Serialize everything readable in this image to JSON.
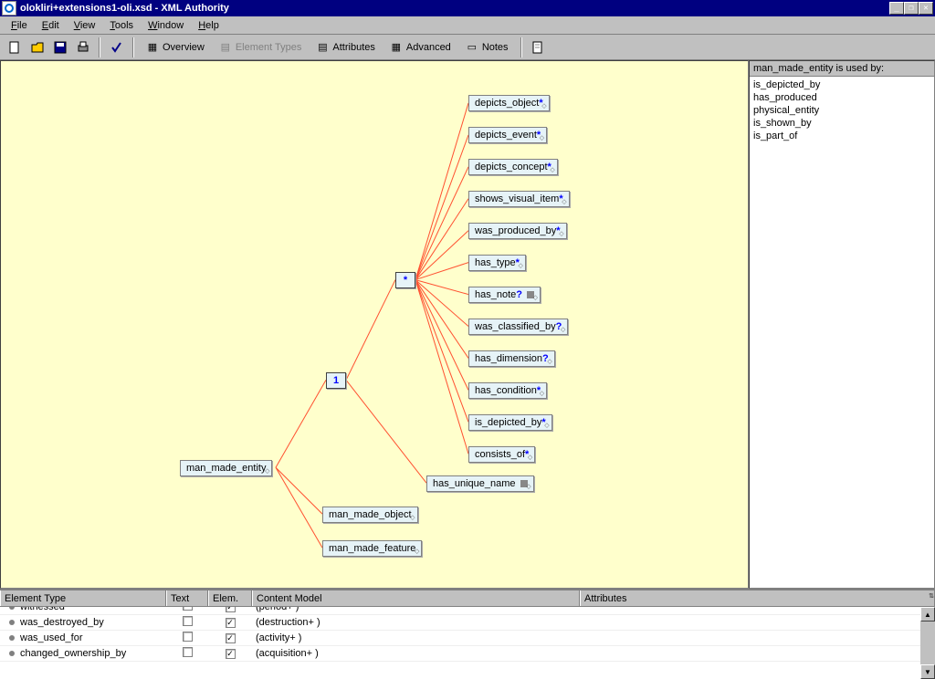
{
  "title": "olokliri+extensions1-oli.xsd - XML Authority",
  "menu": {
    "file": "File",
    "edit": "Edit",
    "view": "View",
    "tools": "Tools",
    "window": "Window",
    "help": "Help"
  },
  "toolbar": {
    "overview": "Overview",
    "elemtypes": "Element Types",
    "attributes": "Attributes",
    "advanced": "Advanced",
    "notes": "Notes"
  },
  "tree": {
    "root": "man_made_entity",
    "seq_card": "1",
    "choice_card": "*",
    "children_star": [
      {
        "label": "depicts_object",
        "suf": "*"
      },
      {
        "label": "depicts_event",
        "suf": "*"
      },
      {
        "label": "depicts_concept",
        "suf": "*"
      },
      {
        "label": "shows_visual_item",
        "suf": "*"
      },
      {
        "label": "was_produced_by",
        "suf": "*"
      },
      {
        "label": "has_type",
        "suf": "*"
      },
      {
        "label": "has_note",
        "suf": "?",
        "note": true
      },
      {
        "label": "was_classified_by",
        "suf": "?"
      },
      {
        "label": "has_dimension",
        "suf": "?"
      },
      {
        "label": "has_condition",
        "suf": "*"
      },
      {
        "label": "is_depicted_by",
        "suf": "*"
      },
      {
        "label": "consists_of",
        "suf": "*"
      }
    ],
    "unique": "has_unique_name",
    "ext1": "man_made_object",
    "ext2": "man_made_feature"
  },
  "side": {
    "header": "man_made_entity is used by:",
    "items": [
      "is_depicted_by",
      "has_produced",
      "physical_entity",
      "is_shown_by",
      "is_part_of"
    ]
  },
  "table": {
    "cols": {
      "et": "Element Type",
      "text": "Text",
      "elem": "Elem.",
      "cm": "Content Model",
      "attr": "Attributes"
    },
    "rows": [
      {
        "name": "witnessed",
        "text": false,
        "elem": true,
        "cm": "(period+ )",
        "cut": true
      },
      {
        "name": "was_destroyed_by",
        "text": false,
        "elem": true,
        "cm": "(destruction+ )"
      },
      {
        "name": "was_used_for",
        "text": false,
        "elem": true,
        "cm": "(activity+ )"
      },
      {
        "name": "changed_ownership_by",
        "text": false,
        "elem": true,
        "cm": "(acquisition+ )"
      }
    ]
  }
}
